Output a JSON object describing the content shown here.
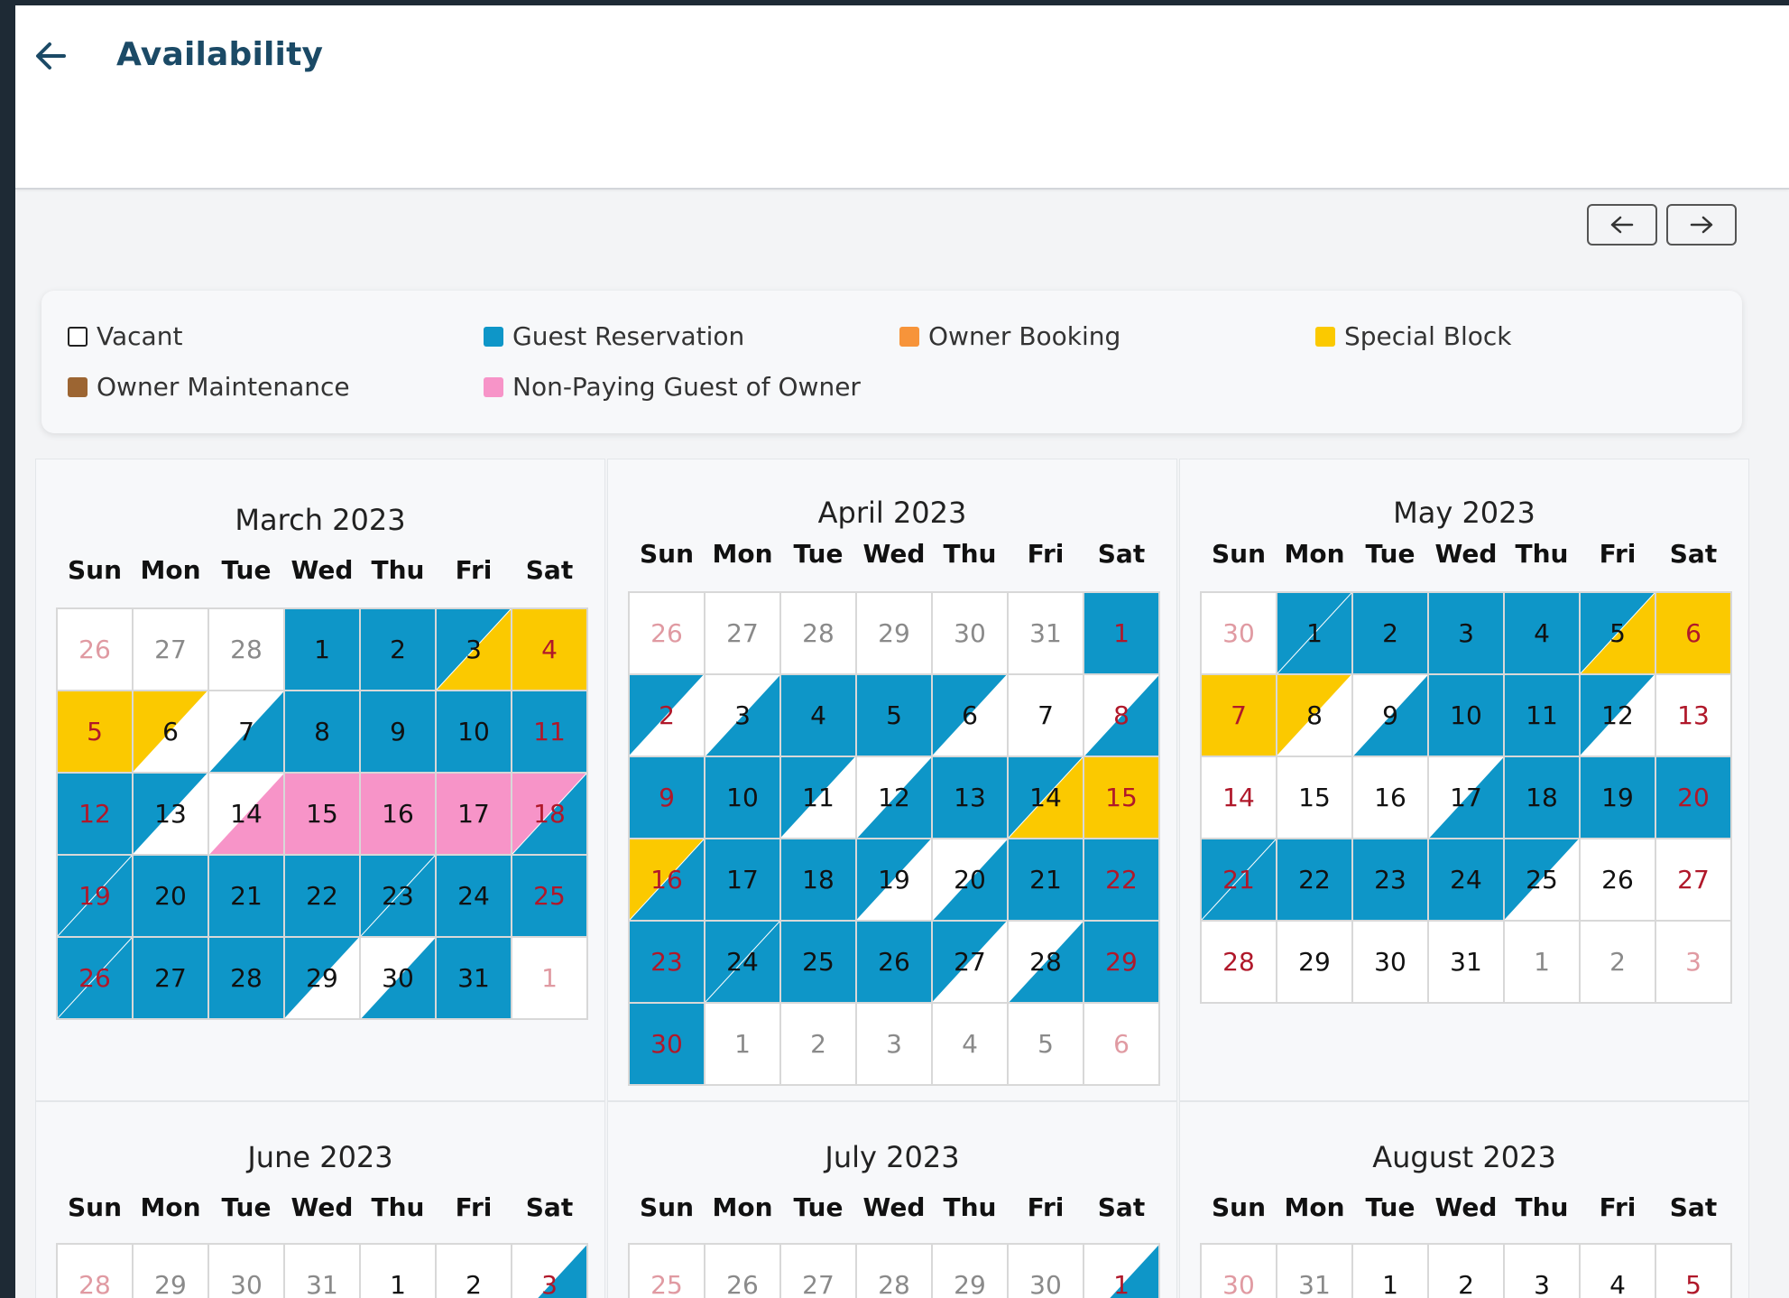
{
  "header": {
    "title": "Availability"
  },
  "nav": {
    "prev_label": "previous months",
    "next_label": "next months"
  },
  "colors": {
    "vacant": "#ffffff",
    "guest": "#0e96c8",
    "owner": "#f7943a",
    "special": "#fbc900",
    "maintenance": "#9c6532",
    "nonpaying": "#f794c8",
    "weekend_text": "#b0182a",
    "title_color": "#1b4a66"
  },
  "legend": [
    {
      "key": "vacant",
      "label": "Vacant"
    },
    {
      "key": "guest",
      "label": "Guest Reservation"
    },
    {
      "key": "owner",
      "label": "Owner Booking"
    },
    {
      "key": "special",
      "label": "Special Block"
    },
    {
      "key": "maintenance",
      "label": "Owner Maintenance"
    },
    {
      "key": "nonpaying",
      "label": "Non-Paying Guest of Owner"
    }
  ],
  "weekdays": [
    "Sun",
    "Mon",
    "Tue",
    "Wed",
    "Thu",
    "Fri",
    "Sat"
  ],
  "months": [
    {
      "title": "March 2023",
      "days": [
        {
          "d": "26",
          "o": true
        },
        {
          "d": "27",
          "o": true
        },
        {
          "d": "28",
          "o": true
        },
        {
          "d": "1",
          "f": "guest"
        },
        {
          "d": "2",
          "f": "guest"
        },
        {
          "d": "3",
          "c": "guest",
          "n": "special"
        },
        {
          "d": "4",
          "f": "special"
        },
        {
          "d": "5",
          "f": "special"
        },
        {
          "d": "6",
          "c": "special",
          "n": "vacant"
        },
        {
          "d": "7",
          "c": "vacant",
          "n": "guest"
        },
        {
          "d": "8",
          "f": "guest"
        },
        {
          "d": "9",
          "f": "guest"
        },
        {
          "d": "10",
          "f": "guest"
        },
        {
          "d": "11",
          "f": "guest"
        },
        {
          "d": "12",
          "f": "guest"
        },
        {
          "d": "13",
          "c": "guest",
          "n": "vacant"
        },
        {
          "d": "14",
          "c": "vacant",
          "n": "nonpaying"
        },
        {
          "d": "15",
          "f": "nonpaying"
        },
        {
          "d": "16",
          "f": "nonpaying"
        },
        {
          "d": "17",
          "f": "nonpaying"
        },
        {
          "d": "18",
          "c": "nonpaying",
          "n": "guest"
        },
        {
          "d": "19",
          "c": "guest",
          "n": "guest"
        },
        {
          "d": "20",
          "f": "guest"
        },
        {
          "d": "21",
          "f": "guest"
        },
        {
          "d": "22",
          "f": "guest"
        },
        {
          "d": "23",
          "c": "guest",
          "n": "guest"
        },
        {
          "d": "24",
          "f": "guest"
        },
        {
          "d": "25",
          "f": "guest"
        },
        {
          "d": "26",
          "c": "guest",
          "n": "guest"
        },
        {
          "d": "27",
          "f": "guest"
        },
        {
          "d": "28",
          "f": "guest"
        },
        {
          "d": "29",
          "c": "guest",
          "n": "vacant"
        },
        {
          "d": "30",
          "c": "vacant",
          "n": "guest"
        },
        {
          "d": "31",
          "f": "guest"
        },
        {
          "d": "1",
          "o": true
        }
      ]
    },
    {
      "title": "April 2023",
      "days": [
        {
          "d": "26",
          "o": true
        },
        {
          "d": "27",
          "o": true
        },
        {
          "d": "28",
          "o": true
        },
        {
          "d": "29",
          "o": true
        },
        {
          "d": "30",
          "o": true
        },
        {
          "d": "31",
          "o": true
        },
        {
          "d": "1",
          "f": "guest"
        },
        {
          "d": "2",
          "c": "guest",
          "n": "vacant"
        },
        {
          "d": "3",
          "c": "vacant",
          "n": "guest"
        },
        {
          "d": "4",
          "f": "guest"
        },
        {
          "d": "5",
          "f": "guest"
        },
        {
          "d": "6",
          "c": "guest",
          "n": "vacant"
        },
        {
          "d": "7",
          "f": "vacant"
        },
        {
          "d": "8",
          "c": "vacant",
          "n": "guest"
        },
        {
          "d": "9",
          "f": "guest"
        },
        {
          "d": "10",
          "f": "guest"
        },
        {
          "d": "11",
          "c": "guest",
          "n": "vacant"
        },
        {
          "d": "12",
          "c": "vacant",
          "n": "guest"
        },
        {
          "d": "13",
          "f": "guest"
        },
        {
          "d": "14",
          "c": "guest",
          "n": "special"
        },
        {
          "d": "15",
          "f": "special"
        },
        {
          "d": "16",
          "c": "special",
          "n": "guest"
        },
        {
          "d": "17",
          "f": "guest"
        },
        {
          "d": "18",
          "f": "guest"
        },
        {
          "d": "19",
          "c": "guest",
          "n": "vacant"
        },
        {
          "d": "20",
          "c": "vacant",
          "n": "guest"
        },
        {
          "d": "21",
          "f": "guest"
        },
        {
          "d": "22",
          "f": "guest"
        },
        {
          "d": "23",
          "f": "guest"
        },
        {
          "d": "24",
          "c": "guest",
          "n": "guest"
        },
        {
          "d": "25",
          "f": "guest"
        },
        {
          "d": "26",
          "f": "guest"
        },
        {
          "d": "27",
          "c": "guest",
          "n": "vacant"
        },
        {
          "d": "28",
          "c": "vacant",
          "n": "guest"
        },
        {
          "d": "29",
          "f": "guest"
        },
        {
          "d": "30",
          "f": "guest"
        },
        {
          "d": "1",
          "o": true
        },
        {
          "d": "2",
          "o": true
        },
        {
          "d": "3",
          "o": true
        },
        {
          "d": "4",
          "o": true
        },
        {
          "d": "5",
          "o": true
        },
        {
          "d": "6",
          "o": true
        }
      ]
    },
    {
      "title": "May 2023",
      "days": [
        {
          "d": "30",
          "o": true
        },
        {
          "d": "1",
          "c": "guest",
          "n": "guest"
        },
        {
          "d": "2",
          "f": "guest"
        },
        {
          "d": "3",
          "f": "guest"
        },
        {
          "d": "4",
          "f": "guest"
        },
        {
          "d": "5",
          "c": "guest",
          "n": "special"
        },
        {
          "d": "6",
          "f": "special"
        },
        {
          "d": "7",
          "f": "special"
        },
        {
          "d": "8",
          "c": "special",
          "n": "vacant"
        },
        {
          "d": "9",
          "c": "vacant",
          "n": "guest"
        },
        {
          "d": "10",
          "f": "guest"
        },
        {
          "d": "11",
          "f": "guest"
        },
        {
          "d": "12",
          "c": "guest",
          "n": "vacant"
        },
        {
          "d": "13",
          "f": "vacant"
        },
        {
          "d": "14",
          "f": "vacant"
        },
        {
          "d": "15",
          "f": "vacant"
        },
        {
          "d": "16",
          "f": "vacant"
        },
        {
          "d": "17",
          "c": "vacant",
          "n": "guest"
        },
        {
          "d": "18",
          "f": "guest"
        },
        {
          "d": "19",
          "f": "guest"
        },
        {
          "d": "20",
          "f": "guest"
        },
        {
          "d": "21",
          "c": "guest",
          "n": "guest"
        },
        {
          "d": "22",
          "f": "guest"
        },
        {
          "d": "23",
          "f": "guest"
        },
        {
          "d": "24",
          "f": "guest"
        },
        {
          "d": "25",
          "c": "guest",
          "n": "vacant"
        },
        {
          "d": "26",
          "f": "vacant"
        },
        {
          "d": "27",
          "f": "vacant"
        },
        {
          "d": "28",
          "f": "vacant"
        },
        {
          "d": "29",
          "f": "vacant"
        },
        {
          "d": "30",
          "f": "vacant"
        },
        {
          "d": "31",
          "f": "vacant"
        },
        {
          "d": "1",
          "o": true
        },
        {
          "d": "2",
          "o": true
        },
        {
          "d": "3",
          "o": true
        }
      ]
    },
    {
      "title": "June 2023",
      "days": [
        {
          "d": "28",
          "o": true
        },
        {
          "d": "29",
          "o": true
        },
        {
          "d": "30",
          "o": true
        },
        {
          "d": "31",
          "o": true
        },
        {
          "d": "1",
          "f": "vacant"
        },
        {
          "d": "2",
          "f": "vacant"
        },
        {
          "d": "3",
          "c": "vacant",
          "n": "guest"
        }
      ]
    },
    {
      "title": "July 2023",
      "days": [
        {
          "d": "25",
          "o": true
        },
        {
          "d": "26",
          "o": true
        },
        {
          "d": "27",
          "o": true
        },
        {
          "d": "28",
          "o": true
        },
        {
          "d": "29",
          "o": true
        },
        {
          "d": "30",
          "o": true
        },
        {
          "d": "1",
          "c": "vacant",
          "n": "guest"
        }
      ]
    },
    {
      "title": "August 2023",
      "days": [
        {
          "d": "30",
          "o": true
        },
        {
          "d": "31",
          "o": true
        },
        {
          "d": "1",
          "f": "vacant"
        },
        {
          "d": "2",
          "f": "vacant"
        },
        {
          "d": "3",
          "f": "vacant"
        },
        {
          "d": "4",
          "f": "vacant"
        },
        {
          "d": "5",
          "f": "vacant"
        }
      ]
    }
  ]
}
